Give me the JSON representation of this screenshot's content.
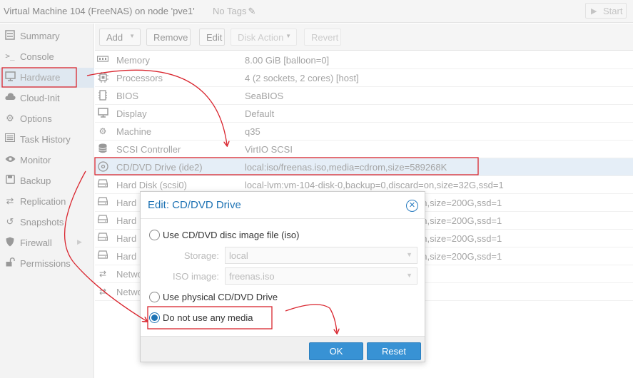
{
  "header": {
    "vm_title": "Virtual Machine 104 (FreeNAS) on node 'pve1'",
    "tags_label": "No Tags",
    "start_label": "Start"
  },
  "sidebar": {
    "items": [
      {
        "label": "Summary",
        "icon": "summary-icon"
      },
      {
        "label": "Console",
        "icon": "console-icon"
      },
      {
        "label": "Hardware",
        "icon": "monitor-icon"
      },
      {
        "label": "Cloud-Init",
        "icon": "cloud-icon"
      },
      {
        "label": "Options",
        "icon": "gear-icon"
      },
      {
        "label": "Task History",
        "icon": "list-icon"
      },
      {
        "label": "Monitor",
        "icon": "eye-icon"
      },
      {
        "label": "Backup",
        "icon": "floppy-icon"
      },
      {
        "label": "Replication",
        "icon": "retweet-icon"
      },
      {
        "label": "Snapshots",
        "icon": "history-icon"
      },
      {
        "label": "Firewall",
        "icon": "shield-icon"
      },
      {
        "label": "Permissions",
        "icon": "unlock-icon"
      }
    ]
  },
  "toolbar": {
    "add": "Add",
    "remove": "Remove",
    "edit": "Edit",
    "disk_action": "Disk Action",
    "revert": "Revert"
  },
  "hardware": [
    {
      "name": "Memory",
      "value": "8.00 GiB [balloon=0]",
      "icon": "memory-icon"
    },
    {
      "name": "Processors",
      "value": "4 (2 sockets, 2 cores) [host]",
      "icon": "cpu-icon"
    },
    {
      "name": "BIOS",
      "value": "SeaBIOS",
      "icon": "microchip-icon"
    },
    {
      "name": "Display",
      "value": "Default",
      "icon": "desktop-icon"
    },
    {
      "name": "Machine",
      "value": "q35",
      "icon": "cogs-icon"
    },
    {
      "name": "SCSI Controller",
      "value": "VirtIO SCSI",
      "icon": "database-icon"
    },
    {
      "name": "CD/DVD Drive (ide2)",
      "value": "local:iso/freenas.iso,media=cdrom,size=589268K",
      "icon": "cdrom-icon"
    },
    {
      "name": "Hard Disk (scsi0)",
      "value": "local-lvm:vm-104-disk-0,backup=0,discard=on,size=32G,ssd=1",
      "icon": "hdd-icon"
    },
    {
      "name": "Hard",
      "value": "on,size=200G,ssd=1",
      "icon": "hdd-icon"
    },
    {
      "name": "Hard",
      "value": "on,size=200G,ssd=1",
      "icon": "hdd-icon"
    },
    {
      "name": "Hard",
      "value": "on,size=200G,ssd=1",
      "icon": "hdd-icon"
    },
    {
      "name": "Hard",
      "value": "on,size=200G,ssd=1",
      "icon": "hdd-icon"
    },
    {
      "name": "Netwo",
      "value": "",
      "icon": "network-icon"
    },
    {
      "name": "Netwo",
      "value": "",
      "icon": "network-icon"
    }
  ],
  "dialog": {
    "title": "Edit: CD/DVD Drive",
    "option_iso": "Use CD/DVD disc image file (iso)",
    "storage_label": "Storage:",
    "storage_value": "local",
    "iso_label": "ISO image:",
    "iso_value": "freenas.iso",
    "option_physical": "Use physical CD/DVD Drive",
    "option_none": "Do not use any media",
    "selected_option": "none",
    "ok": "OK",
    "reset": "Reset"
  },
  "colors": {
    "accent": "#1e73b4",
    "button_blue": "#3892d4",
    "annotation_red": "#d9252e",
    "selected_row": "#e5eef7"
  }
}
